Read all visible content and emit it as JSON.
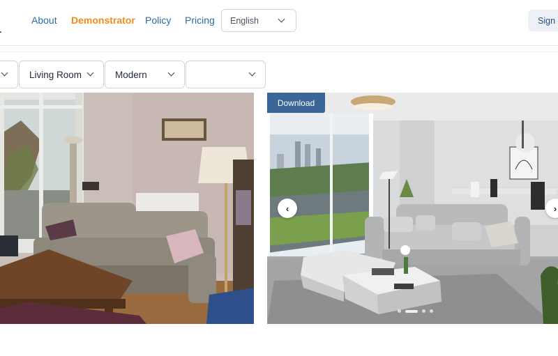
{
  "nav": {
    "links": [
      {
        "label": "About",
        "active": false
      },
      {
        "label": "Demonstrator",
        "active": true
      },
      {
        "label": "Policy",
        "active": false
      },
      {
        "label": "Pricing",
        "active": false
      }
    ],
    "language_selected": "English",
    "signup_label": "Sign u"
  },
  "filters": {
    "first_value": "",
    "room_type": "Living Room",
    "style": "Modern",
    "fourth_value": ""
  },
  "result": {
    "download_label": "Download",
    "prev_glyph": "‹",
    "next_glyph": "›",
    "slide_count": 4,
    "active_slide": 2
  },
  "colors": {
    "link": "#2b6aa8",
    "active_link": "#f08c1a",
    "download_button": "#3a6596",
    "signup_bg": "#eef0f7"
  },
  "icons": [
    "chevron-down-icon",
    "chevron-left-icon",
    "chevron-right-icon"
  ]
}
